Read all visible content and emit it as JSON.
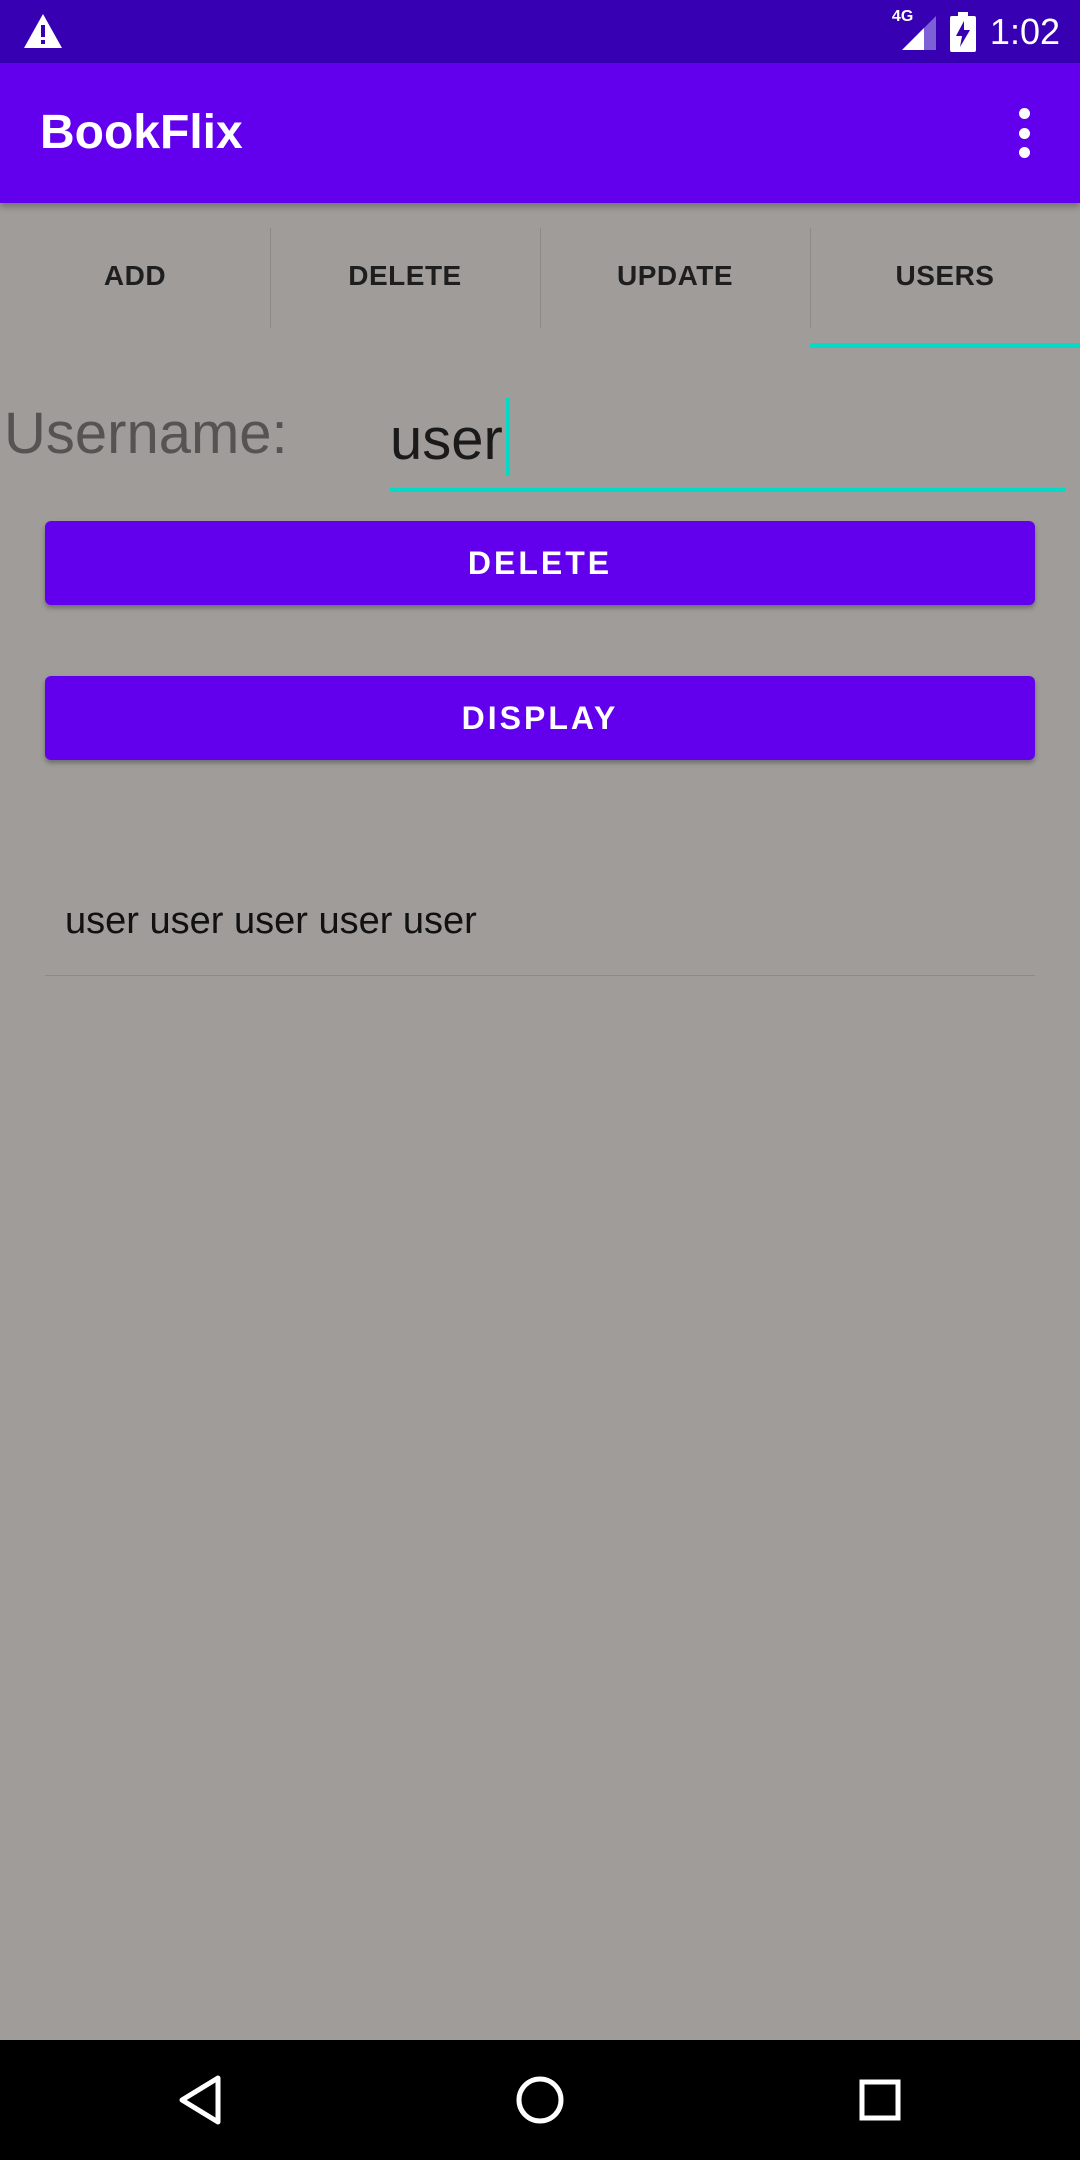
{
  "status_bar": {
    "network": "4G",
    "time": "1:02",
    "icons": [
      "warning-icon",
      "signal-icon",
      "battery-charging-icon"
    ]
  },
  "app_bar": {
    "title": "BookFlix",
    "menu_icon": "overflow-menu-icon"
  },
  "tabs": [
    {
      "label": "ADD"
    },
    {
      "label": "DELETE"
    },
    {
      "label": "UPDATE"
    },
    {
      "label": "USERS",
      "active": true
    }
  ],
  "form": {
    "username_label": "Username:",
    "username_value": "user"
  },
  "buttons": {
    "delete_label": "DELETE",
    "display_label": "DISPLAY"
  },
  "list": {
    "items": [
      "user user user user user"
    ]
  },
  "nav_bar": {
    "icons": [
      "back-icon",
      "home-icon",
      "recents-icon"
    ]
  },
  "colors": {
    "primary": "#6200ee",
    "primary_dark": "#3700b3",
    "accent": "#03dac5",
    "background": "#9f9c99"
  }
}
